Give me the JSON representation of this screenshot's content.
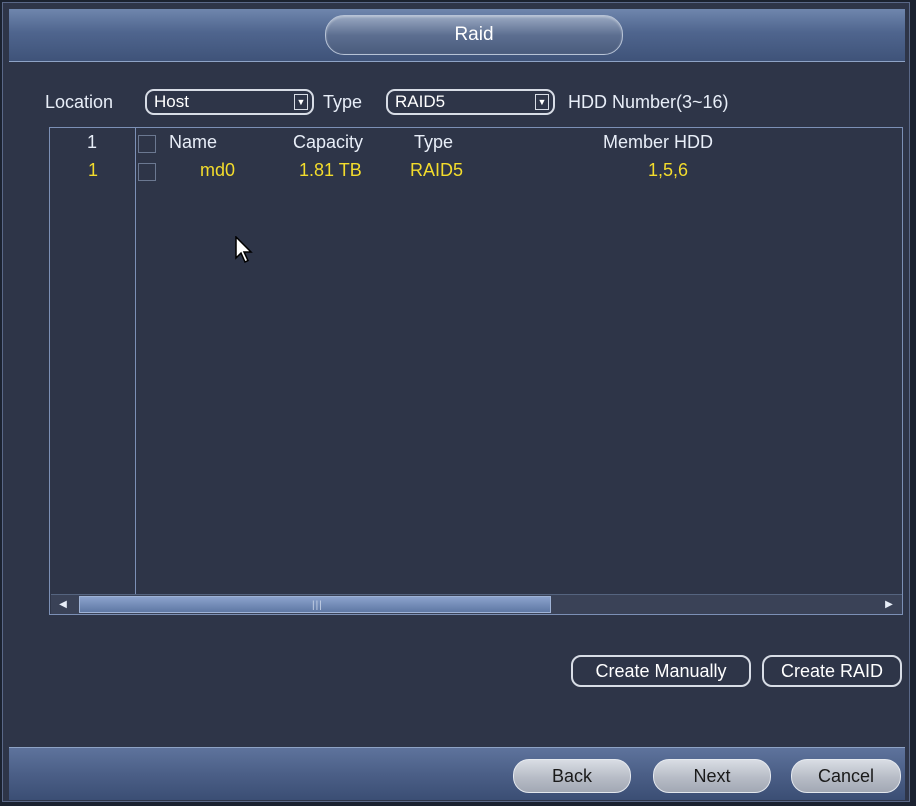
{
  "window": {
    "title": "Raid"
  },
  "controls": {
    "location_label": "Location",
    "location_value": "Host",
    "type_label": "Type",
    "type_value": "RAID5",
    "hdd_number_label": "HDD Number(3~16)"
  },
  "table": {
    "header": {
      "index": "1",
      "name": "Name",
      "capacity": "Capacity",
      "type": "Type",
      "member_hdd": "Member HDD"
    },
    "rows": [
      {
        "index": "1",
        "name": "md0",
        "capacity": "1.81 TB",
        "type": "RAID5",
        "member_hdd": "1,5,6",
        "checked": false
      }
    ]
  },
  "actions": {
    "create_manually": "Create Manually",
    "create_raid": "Create RAID"
  },
  "footer": {
    "back": "Back",
    "next": "Next",
    "cancel": "Cancel"
  },
  "colors": {
    "background": "#2e3548",
    "row_text": "#f3dc2c",
    "title_bar": "#4f658e",
    "border": "#7c90b6"
  },
  "icons": {
    "dropdown": "chevron-down-icon",
    "scroll_left": "arrow-left-icon",
    "scroll_right": "arrow-right-icon",
    "cursor": "mouse-pointer-icon"
  }
}
